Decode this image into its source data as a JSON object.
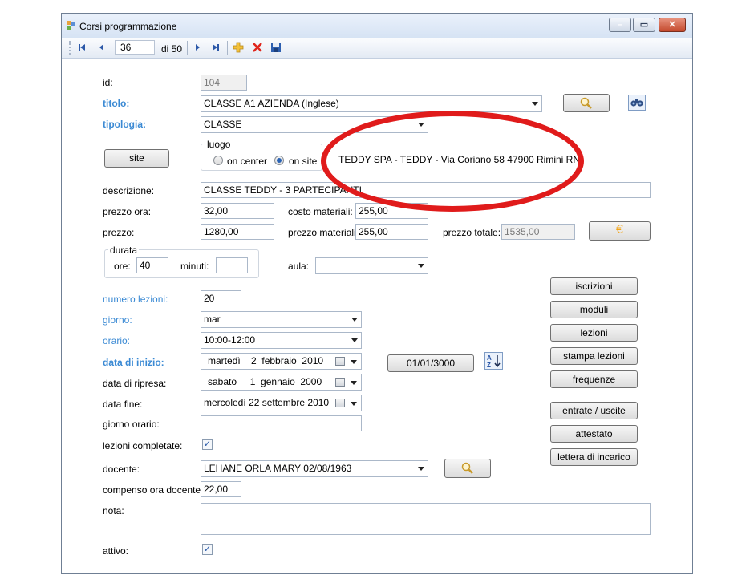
{
  "window": {
    "title": "Corsi programmazione"
  },
  "toolbar": {
    "record": "36",
    "of_total": "di 50"
  },
  "form": {
    "id_label": "id:",
    "id_value": "104",
    "titolo_label": "titolo:",
    "titolo_value": "CLASSE A1 AZIENDA (Inglese)",
    "tipologia_label": "tipologia:",
    "tipologia_value": "CLASSE",
    "site_button": "site",
    "luogo_label": "luogo",
    "on_center": "on center",
    "on_site": "on site",
    "luogo_selected": "on site",
    "site_address": "TEDDY SPA  -  TEDDY -  Via Coriano 58 47900 Rimini RN",
    "descrizione_label": "descrizione:",
    "descrizione_value": "CLASSE TEDDY - 3 PARTECIPANTI",
    "prezzo_ora_label": "prezzo ora:",
    "prezzo_ora_value": "32,00",
    "costo_materiali_label": "costo materiali:",
    "costo_materiali_value": "255,00",
    "prezzo_label": "prezzo:",
    "prezzo_value": "1280,00",
    "prezzo_materiali_label": "prezzo materiali:",
    "prezzo_materiali_value": "255,00",
    "prezzo_totale_label": "prezzo totale:",
    "prezzo_totale_value": "1535,00",
    "euro_symbol": "€",
    "durata_label": "durata",
    "ore_label": "ore:",
    "ore_value": "40",
    "minuti_label": "minuti:",
    "minuti_value": "",
    "aula_label": "aula:",
    "aula_value": "",
    "numero_lezioni_label": "numero lezioni:",
    "numero_lezioni_value": "20",
    "giorno_label": "giorno:",
    "giorno_value": "mar",
    "orario_label": "orario:",
    "orario_value": "10:00-12:00",
    "data_inizio_label": "data di inizio:",
    "data_inizio_value": "martedì    2  febbraio  2010",
    "date_button": "01/01/3000",
    "data_ripresa_label": "data di ripresa:",
    "data_ripresa_value": "sabato     1  gennaio  2000",
    "data_fine_label": "data fine:",
    "data_fine_value": "mercoledì 22 settembre 2010",
    "giorno_orario_label": "giorno orario:",
    "giorno_orario_value": "",
    "lezioni_completate_label": "lezioni completate:",
    "lezioni_completate_checked": true,
    "docente_label": "docente:",
    "docente_value": "LEHANE ORLA MARY 02/08/1963",
    "compenso_label": "compenso ora docente:",
    "compenso_value": "22,00",
    "nota_label": "nota:",
    "nota_value": "",
    "attivo_label": "attivo:",
    "attivo_checked": true
  },
  "side_buttons": {
    "iscrizioni": "iscrizioni",
    "moduli": "moduli",
    "lezioni": "lezioni",
    "stampa_lezioni": "stampa lezioni",
    "frequenze": "frequenze",
    "entrate_uscite": "entrate / uscite",
    "attestato": "attestato",
    "lettera_incarico": "lettera di incarico"
  },
  "colors": {
    "highlight_ellipse": "#e01b1b",
    "label_blue": "#3b8ad4",
    "client_bg": "#ffffff",
    "frame": "#e6eef8"
  }
}
